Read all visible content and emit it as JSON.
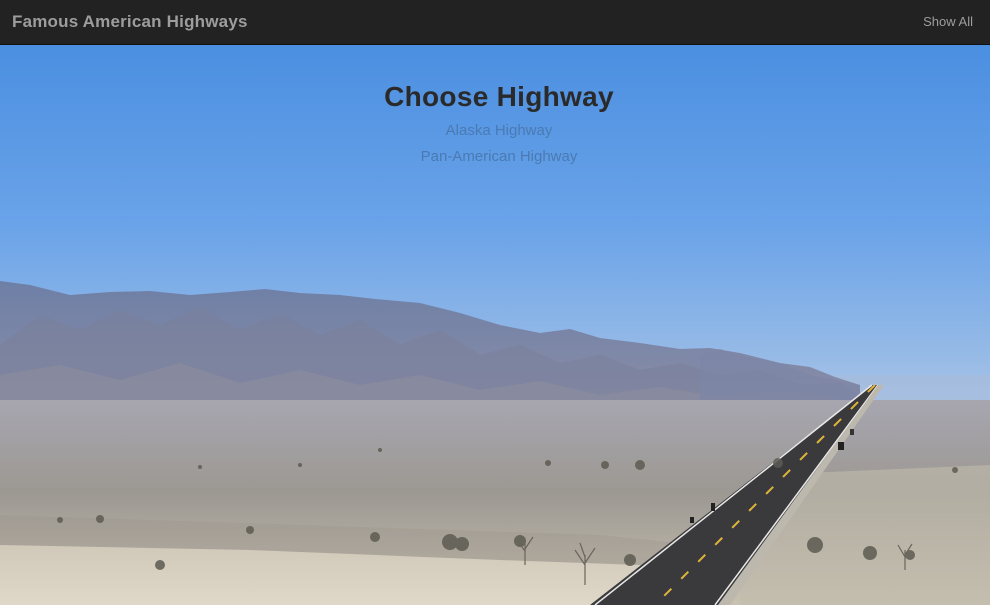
{
  "navbar": {
    "brand": "Famous American Highways",
    "show_all": "Show All"
  },
  "hero": {
    "heading": "Choose Highway",
    "highways": [
      {
        "label": "Alaska Highway"
      },
      {
        "label": "Pan-American Highway"
      }
    ],
    "image": "desert highway with mountains under blue sky"
  },
  "colors": {
    "navbar_bg": "#222222",
    "navbar_text": "#9d9d9d",
    "heading": "#2a2a2a",
    "link": "#4a7ab3",
    "sky_top": "#4a8fe0",
    "sky_bottom": "#8ab6ec"
  }
}
